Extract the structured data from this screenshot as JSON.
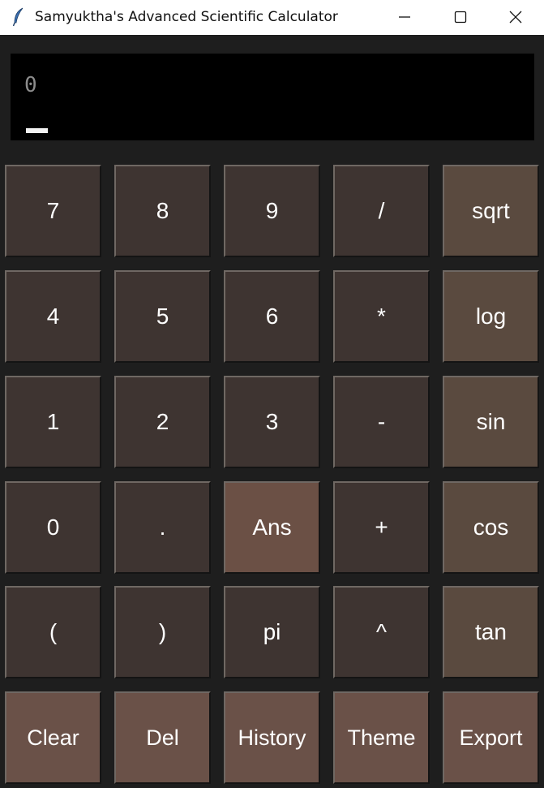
{
  "window": {
    "title": "Samyuktha's Advanced Scientific Calculator",
    "app_icon": "feather-icon",
    "controls": [
      "minimize-icon",
      "maximize-icon",
      "close-icon"
    ]
  },
  "display": {
    "value": "0",
    "cursor_visible": true
  },
  "keys": {
    "row1": [
      "7",
      "8",
      "9",
      "/",
      "sqrt"
    ],
    "row2": [
      "4",
      "5",
      "6",
      "*",
      "log"
    ],
    "row3": [
      "1",
      "2",
      "3",
      "-",
      "sin"
    ],
    "row4": [
      "0",
      ".",
      "Ans",
      "+",
      "cos"
    ],
    "row5": [
      "(",
      ")",
      "pi",
      "^",
      "tan"
    ],
    "row6": [
      "Clear",
      "Del",
      "History",
      "Theme",
      "Export"
    ]
  },
  "colors": {
    "window_bg": "#1e1e1e",
    "display_bg": "#000000",
    "key_basic": "#3e3431",
    "key_function": "#5a4a3f",
    "key_ans": "#6b5045",
    "key_action": "#6a5148",
    "key_text": "#ffffff"
  }
}
